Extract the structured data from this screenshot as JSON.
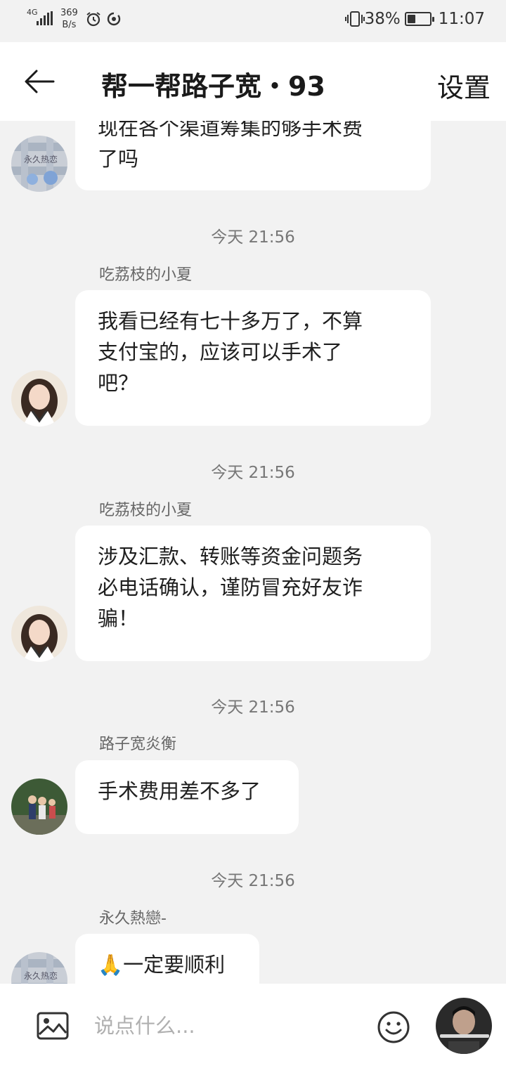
{
  "status_bar": {
    "network": "4G",
    "speed_value": "369",
    "speed_unit": "B/s",
    "battery_percent": "38%",
    "battery_level": 0.38,
    "time": "11:07"
  },
  "header": {
    "title": "帮一帮路子宽・93",
    "settings_label": "设置"
  },
  "chat": {
    "messages": [
      {
        "sender": "",
        "text": "现在各个渠道筹集的够手术费\n了吗",
        "avatar": "avatar-plaid"
      },
      {
        "time": "今天 21:56",
        "sender": "吃荔枝的小夏",
        "text": "我看已经有七十多万了，不算\n支付宝的，应该可以手术了\n吧？",
        "avatar": "avatar-girl"
      },
      {
        "time": "今天 21:56",
        "sender": "吃荔枝的小夏",
        "text": "涉及汇款、转账等资金问题务\n必电话确认，谨防冒充好友诈\n骗！",
        "avatar": "avatar-girl"
      },
      {
        "time": "今天 21:56",
        "sender": "路子宽炎衡",
        "text": "手术费用差不多了",
        "avatar": "avatar-kids"
      },
      {
        "time": "今天 21:56",
        "sender": "永久熱戀-",
        "text": "🙏一定要顺利",
        "avatar": "avatar-plaid"
      }
    ]
  },
  "input_bar": {
    "placeholder": "说点什么..."
  },
  "colors": {
    "background": "#f2f2f2",
    "bubble": "#ffffff",
    "timestamp": "#777777"
  }
}
